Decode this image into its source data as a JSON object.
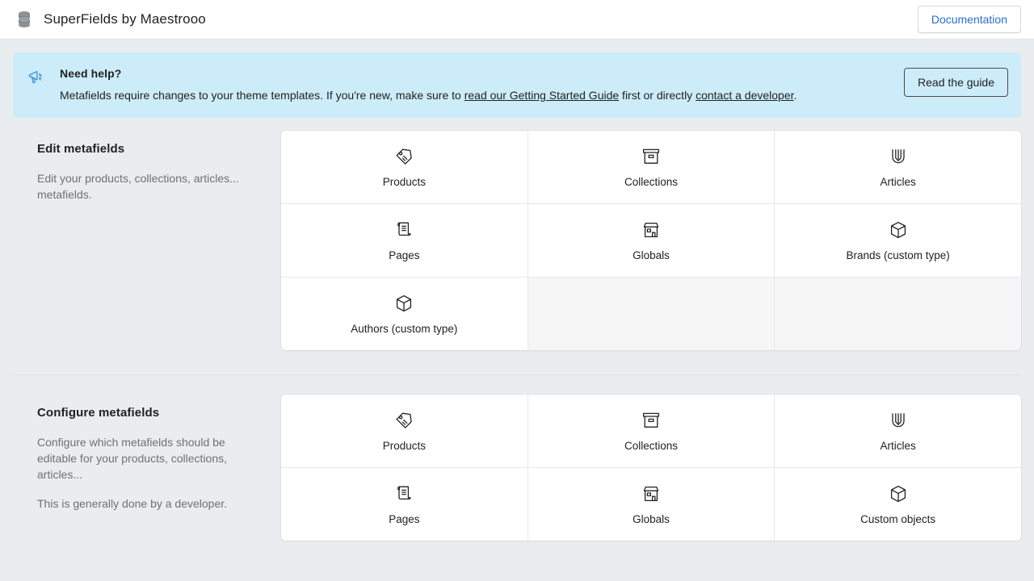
{
  "topbar": {
    "app_icon": "database-stack-icon",
    "title": "SuperFields by Maestrooo",
    "documentation_label": "Documentation"
  },
  "banner": {
    "icon": "megaphone-icon",
    "title": "Need help?",
    "text_part1": "Metafields require changes to your theme templates. If you're new, make sure to ",
    "link1": "read our Getting Started Guide",
    "text_part2": " first or directly ",
    "link2": "contact a developer",
    "text_part3": ".",
    "action_label": "Read the guide",
    "background_color": "#cdecf9"
  },
  "sections": [
    {
      "heading": "Edit metafields",
      "descriptions": [
        "Edit your products, collections, articles... metafields."
      ],
      "items": [
        {
          "label": "Products",
          "icon": "tag-icon"
        },
        {
          "label": "Collections",
          "icon": "archive-box-icon"
        },
        {
          "label": "Articles",
          "icon": "pen-nib-icon"
        },
        {
          "label": "Pages",
          "icon": "scroll-document-icon"
        },
        {
          "label": "Globals",
          "icon": "storefront-icon"
        },
        {
          "label": "Brands (custom type)",
          "icon": "cube-icon"
        },
        {
          "label": "Authors (custom type)",
          "icon": "cube-icon"
        }
      ]
    },
    {
      "heading": "Configure metafields",
      "descriptions": [
        "Configure which metafields should be editable for your products, collections, articles...",
        "This is generally done by a developer."
      ],
      "items": [
        {
          "label": "Products",
          "icon": "tag-icon"
        },
        {
          "label": "Collections",
          "icon": "archive-box-icon"
        },
        {
          "label": "Articles",
          "icon": "pen-nib-icon"
        },
        {
          "label": "Pages",
          "icon": "scroll-document-icon"
        },
        {
          "label": "Globals",
          "icon": "storefront-icon"
        },
        {
          "label": "Custom objects",
          "icon": "cube-icon"
        }
      ]
    }
  ],
  "colors": {
    "page_background": "#eaedef",
    "card_background": "#ffffff",
    "accent_link": "#2c6ecb",
    "muted_text": "#6d7175"
  }
}
